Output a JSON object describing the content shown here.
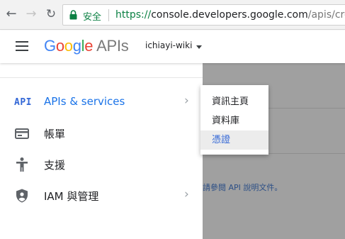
{
  "browser": {
    "back_icon": "arrow-back-icon",
    "forward_icon": "arrow-forward-icon",
    "reload_icon": "reload-icon",
    "lock_icon": "lock-icon",
    "security_label": "安全",
    "url_scheme": "https://",
    "url_host": "console.developers.google.com",
    "url_path": "/apis/cred"
  },
  "header": {
    "menu_icon": "hamburger-menu-icon",
    "logo_google": "Google",
    "logo_apis": "APIs",
    "project_name": "ichiayi-wiki",
    "project_caret_icon": "caret-down-icon"
  },
  "drawer": {
    "items": [
      {
        "icon": "api-icon",
        "icon_text": "API",
        "label": "APIs & services",
        "active": true,
        "has_submenu": true
      },
      {
        "icon": "billing-card-icon",
        "label": "帳單",
        "active": false,
        "has_submenu": false
      },
      {
        "icon": "support-person-icon",
        "label": "支援",
        "active": false,
        "has_submenu": false
      },
      {
        "icon": "iam-shield-icon",
        "label": "IAM 與管理",
        "active": false,
        "has_submenu": true
      }
    ],
    "chevron_icon": "chevron-right-icon"
  },
  "submenu": {
    "items": [
      {
        "label": "資訊主頁",
        "selected": false
      },
      {
        "label": "資料庫",
        "selected": false
      },
      {
        "label": "憑證",
        "selected": true
      }
    ]
  },
  "background_page": {
    "help_text": "請參閱 API 說明文件。"
  },
  "colors": {
    "accent_blue": "#1a73e8",
    "secure_green": "#0b8043",
    "google_blue": "#4285f4",
    "google_red": "#ea4335",
    "google_yellow": "#fbbc05",
    "google_green": "#34a853",
    "overlay_gray": "#a0a0a0"
  }
}
